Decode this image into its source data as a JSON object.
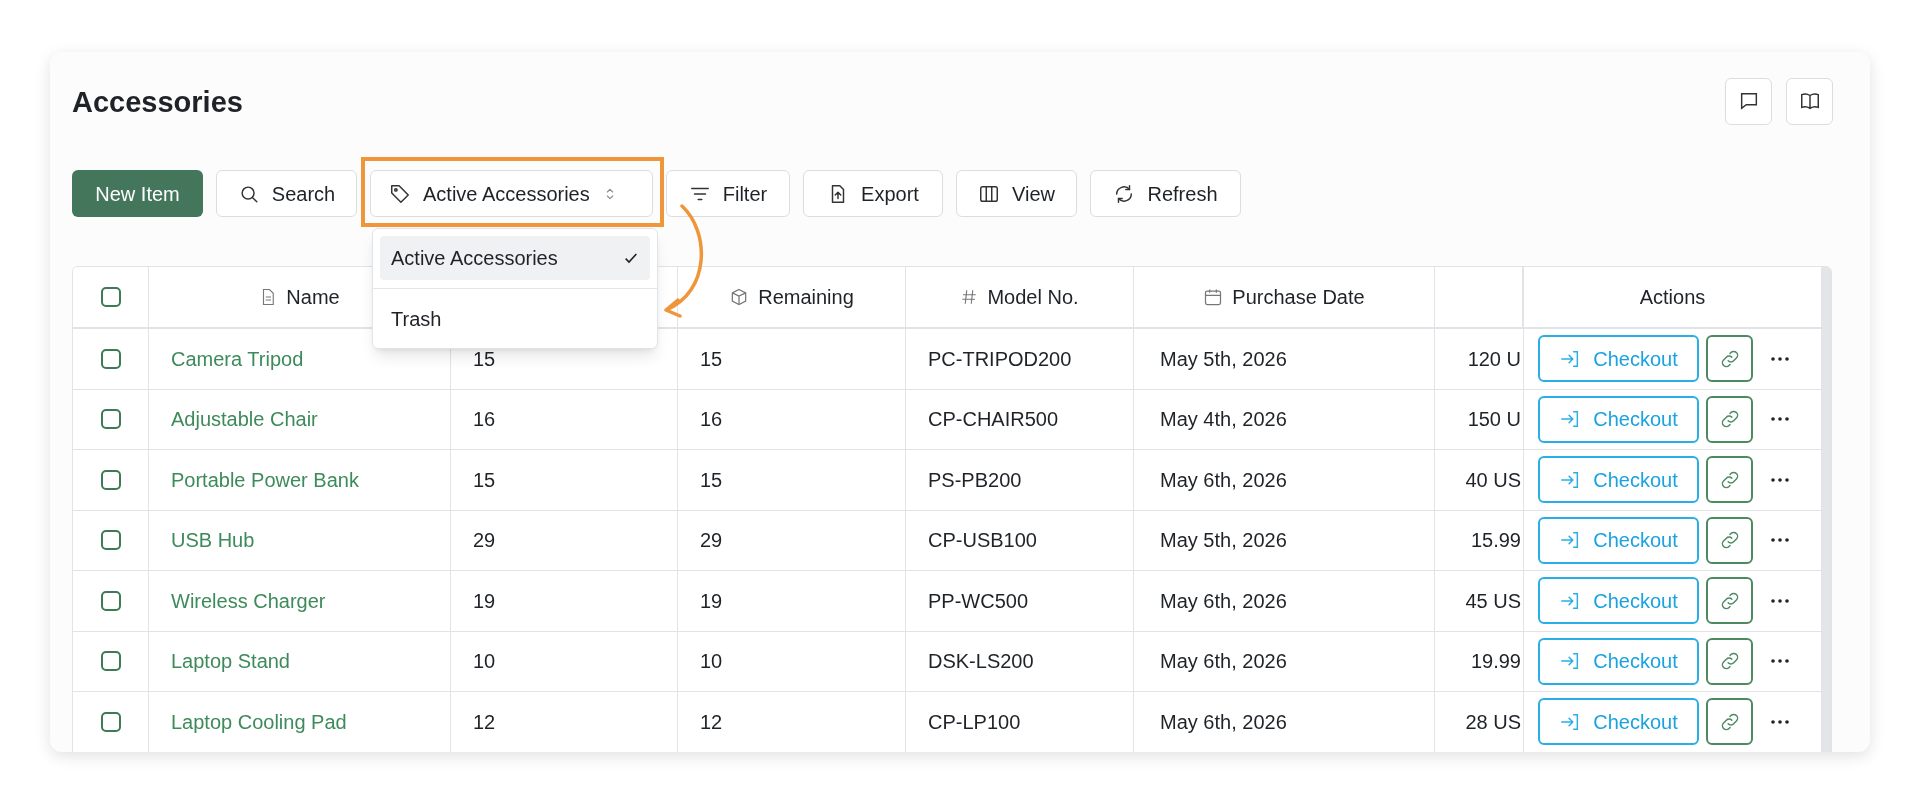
{
  "page": {
    "title": "Accessories"
  },
  "toolbar": {
    "new_item": "New Item",
    "search": "Search",
    "view_select": "Active Accessories",
    "filter": "Filter",
    "export": "Export",
    "view": "View",
    "refresh": "Refresh"
  },
  "view_menu": [
    {
      "label": "Active Accessories",
      "selected": true
    },
    {
      "label": "Trash",
      "selected": false
    }
  ],
  "table": {
    "select_all_checked": false,
    "columns": {
      "name": "Name",
      "remaining": "Remaining",
      "model_no": "Model No.",
      "purchase_date": "Purchase Date",
      "actions": "Actions"
    },
    "rows": [
      {
        "checked": false,
        "name": "Camera Tripod",
        "column_3": "15",
        "remaining": "15",
        "model_no": "PC-TRIPOD200",
        "purchase_date": "May 5th, 2026",
        "column_7": "120 U",
        "action": "Checkout"
      },
      {
        "checked": false,
        "name": "Adjustable Chair",
        "column_3": "16",
        "remaining": "16",
        "model_no": "CP-CHAIR500",
        "purchase_date": "May 4th, 2026",
        "column_7": "150 U",
        "action": "Checkout"
      },
      {
        "checked": false,
        "name": "Portable Power Bank",
        "column_3": "15",
        "remaining": "15",
        "model_no": "PS-PB200",
        "purchase_date": "May 6th, 2026",
        "column_7": "40 US",
        "action": "Checkout"
      },
      {
        "checked": false,
        "name": "USB Hub",
        "column_3": "29",
        "remaining": "29",
        "model_no": "CP-USB100",
        "purchase_date": "May 5th, 2026",
        "column_7": "15.99",
        "action": "Checkout"
      },
      {
        "checked": false,
        "name": "Wireless Charger",
        "column_3": "19",
        "remaining": "19",
        "model_no": "PP-WC500",
        "purchase_date": "May 6th, 2026",
        "column_7": "45 US",
        "action": "Checkout"
      },
      {
        "checked": false,
        "name": "Laptop Stand",
        "column_3": "10",
        "remaining": "10",
        "model_no": "DSK-LS200",
        "purchase_date": "May 6th, 2026",
        "column_7": "19.99",
        "action": "Checkout"
      },
      {
        "checked": false,
        "name": "Laptop Cooling Pad",
        "column_3": "12",
        "remaining": "12",
        "model_no": "CP-LP100",
        "purchase_date": "May 6th, 2026",
        "column_7": "28 US",
        "action": "Checkout"
      }
    ]
  }
}
